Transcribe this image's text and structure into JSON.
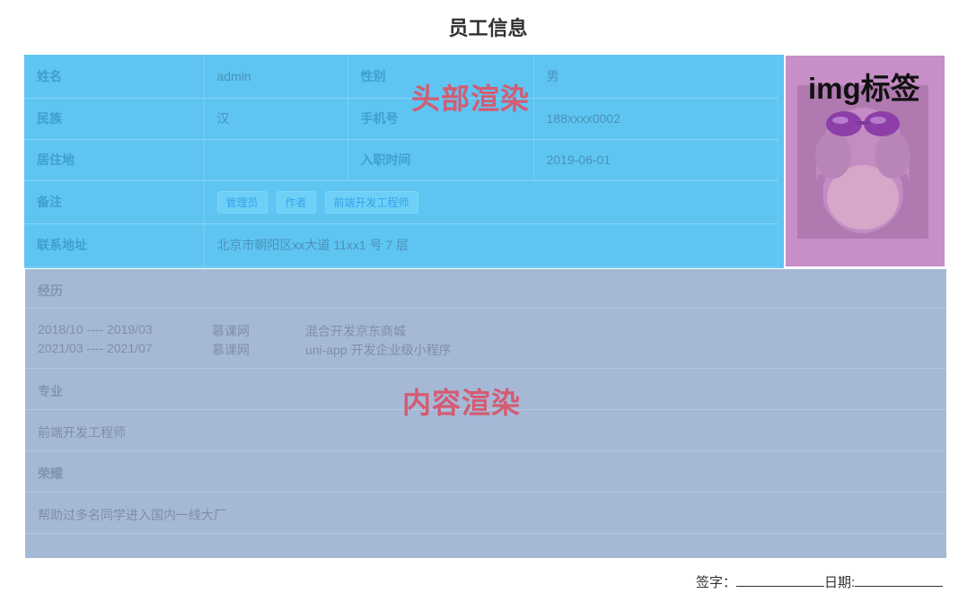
{
  "page": {
    "title": "员工信息"
  },
  "header": {
    "overlay_label": "头部渲染",
    "rows": [
      {
        "l1": "姓名",
        "v1": "admin",
        "l2": "性别",
        "v2": "男"
      },
      {
        "l1": "民族",
        "v1": "汉",
        "l2": "手机号",
        "v2": "188xxxx0002"
      },
      {
        "l1": "居住地",
        "v1": "",
        "l2": "入职时间",
        "v2": "2019-06-01"
      }
    ],
    "remark_label": "备注",
    "tags": [
      "管理员",
      "作者",
      "前端开发工程师"
    ],
    "address_label": "联系地址",
    "address_value": "北京市朝阳区xx大道 11xx1 号 7 层"
  },
  "image_panel": {
    "overlay_label": "img标签",
    "photo_icon": "avatar-photo"
  },
  "content": {
    "overlay_label": "内容渲染",
    "experience_title": "经历",
    "experience": [
      {
        "period": "2018/10 ---- 2019/03",
        "company": "慕课网",
        "project": "混合开发京东商城"
      },
      {
        "period": "2021/03 ---- 2021/07",
        "company": "慕课网",
        "project": "uni-app 开发企业级小程序"
      }
    ],
    "major_title": "专业",
    "major_value": "前端开发工程师",
    "honor_title": "荣耀",
    "honor_value": "帮助过多名同学进入国内一线大厂"
  },
  "footer": {
    "sign_label": "签字：",
    "date_label": "日期:"
  }
}
